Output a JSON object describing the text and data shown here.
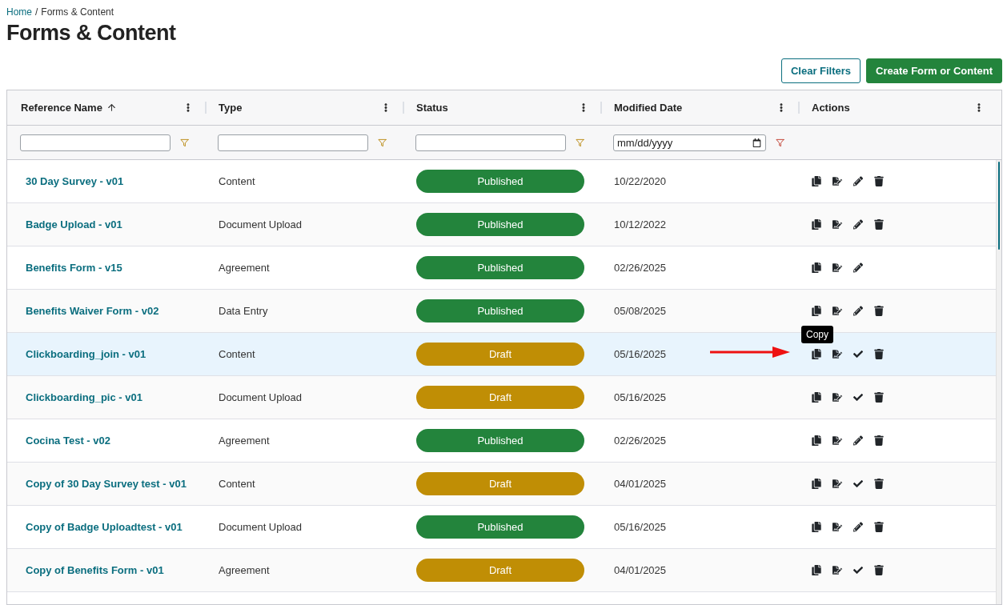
{
  "breadcrumb": {
    "separator": "/",
    "items": [
      {
        "label": "Home",
        "link": true
      },
      {
        "label": "Forms & Content",
        "link": false
      }
    ]
  },
  "title": "Forms & Content",
  "buttons": [
    {
      "label": "Clear Filters",
      "kind": "outline"
    },
    {
      "label": "Create Form or Content",
      "kind": "primary"
    }
  ],
  "columns": [
    {
      "label": "Reference Name",
      "sorted_ascending": true,
      "kind": "text"
    },
    {
      "label": "Type",
      "sorted_ascending": false,
      "kind": "text"
    },
    {
      "label": "Status",
      "sorted_ascending": false,
      "kind": "text"
    },
    {
      "label": "Modified Date",
      "sorted_ascending": false,
      "kind": "date",
      "placeholder": "mm/dd/yyyy"
    },
    {
      "label": "Actions",
      "sorted_ascending": false,
      "kind": "actions"
    }
  ],
  "rows": [
    {
      "name": "30 Day Survey - v01",
      "type": "Content",
      "status": {
        "label": "Published",
        "kind": "published"
      },
      "date": "10/22/2020",
      "selected": false,
      "arrow": false,
      "actions": [
        {
          "kind": "copy"
        },
        {
          "kind": "document"
        },
        {
          "kind": "edit"
        },
        {
          "kind": "delete"
        }
      ]
    },
    {
      "name": "Badge Upload - v01",
      "type": "Document Upload",
      "status": {
        "label": "Published",
        "kind": "published"
      },
      "date": "10/12/2022",
      "selected": false,
      "arrow": false,
      "actions": [
        {
          "kind": "copy"
        },
        {
          "kind": "document"
        },
        {
          "kind": "edit"
        },
        {
          "kind": "delete"
        }
      ]
    },
    {
      "name": "Benefits Form - v15",
      "type": "Agreement",
      "status": {
        "label": "Published",
        "kind": "published"
      },
      "date": "02/26/2025",
      "selected": false,
      "arrow": false,
      "actions": [
        {
          "kind": "copy"
        },
        {
          "kind": "document"
        },
        {
          "kind": "edit"
        }
      ]
    },
    {
      "name": "Benefits Waiver Form - v02",
      "type": "Data Entry",
      "status": {
        "label": "Published",
        "kind": "published"
      },
      "date": "05/08/2025",
      "selected": false,
      "arrow": false,
      "actions": [
        {
          "kind": "copy"
        },
        {
          "kind": "document"
        },
        {
          "kind": "edit"
        },
        {
          "kind": "delete"
        }
      ]
    },
    {
      "name": "Clickboarding_join - v01",
      "type": "Content",
      "status": {
        "label": "Draft",
        "kind": "draft"
      },
      "date": "05/16/2025",
      "selected": true,
      "arrow": true,
      "actions": [
        {
          "kind": "copy",
          "tooltip": "Copy"
        },
        {
          "kind": "document"
        },
        {
          "kind": "publish"
        },
        {
          "kind": "delete"
        }
      ]
    },
    {
      "name": "Clickboarding_pic - v01",
      "type": "Document Upload",
      "status": {
        "label": "Draft",
        "kind": "draft"
      },
      "date": "05/16/2025",
      "selected": false,
      "arrow": false,
      "actions": [
        {
          "kind": "copy"
        },
        {
          "kind": "document"
        },
        {
          "kind": "publish"
        },
        {
          "kind": "delete"
        }
      ]
    },
    {
      "name": "Cocina Test - v02",
      "type": "Agreement",
      "status": {
        "label": "Published",
        "kind": "published"
      },
      "date": "02/26/2025",
      "selected": false,
      "arrow": false,
      "actions": [
        {
          "kind": "copy"
        },
        {
          "kind": "document"
        },
        {
          "kind": "edit"
        },
        {
          "kind": "delete"
        }
      ]
    },
    {
      "name": "Copy of 30 Day Survey test - v01",
      "type": "Content",
      "status": {
        "label": "Draft",
        "kind": "draft"
      },
      "date": "04/01/2025",
      "selected": false,
      "arrow": false,
      "actions": [
        {
          "kind": "copy"
        },
        {
          "kind": "document"
        },
        {
          "kind": "publish"
        },
        {
          "kind": "delete"
        }
      ]
    },
    {
      "name": "Copy of Badge Uploadtest - v01",
      "type": "Document Upload",
      "status": {
        "label": "Published",
        "kind": "published"
      },
      "date": "05/16/2025",
      "selected": false,
      "arrow": false,
      "actions": [
        {
          "kind": "copy"
        },
        {
          "kind": "document"
        },
        {
          "kind": "edit"
        },
        {
          "kind": "delete"
        }
      ]
    },
    {
      "name": "Copy of Benefits Form - v01",
      "type": "Agreement",
      "status": {
        "label": "Draft",
        "kind": "draft"
      },
      "date": "04/01/2025",
      "selected": false,
      "arrow": false,
      "actions": [
        {
          "kind": "copy"
        },
        {
          "kind": "document"
        },
        {
          "kind": "publish"
        },
        {
          "kind": "delete"
        }
      ]
    }
  ]
}
